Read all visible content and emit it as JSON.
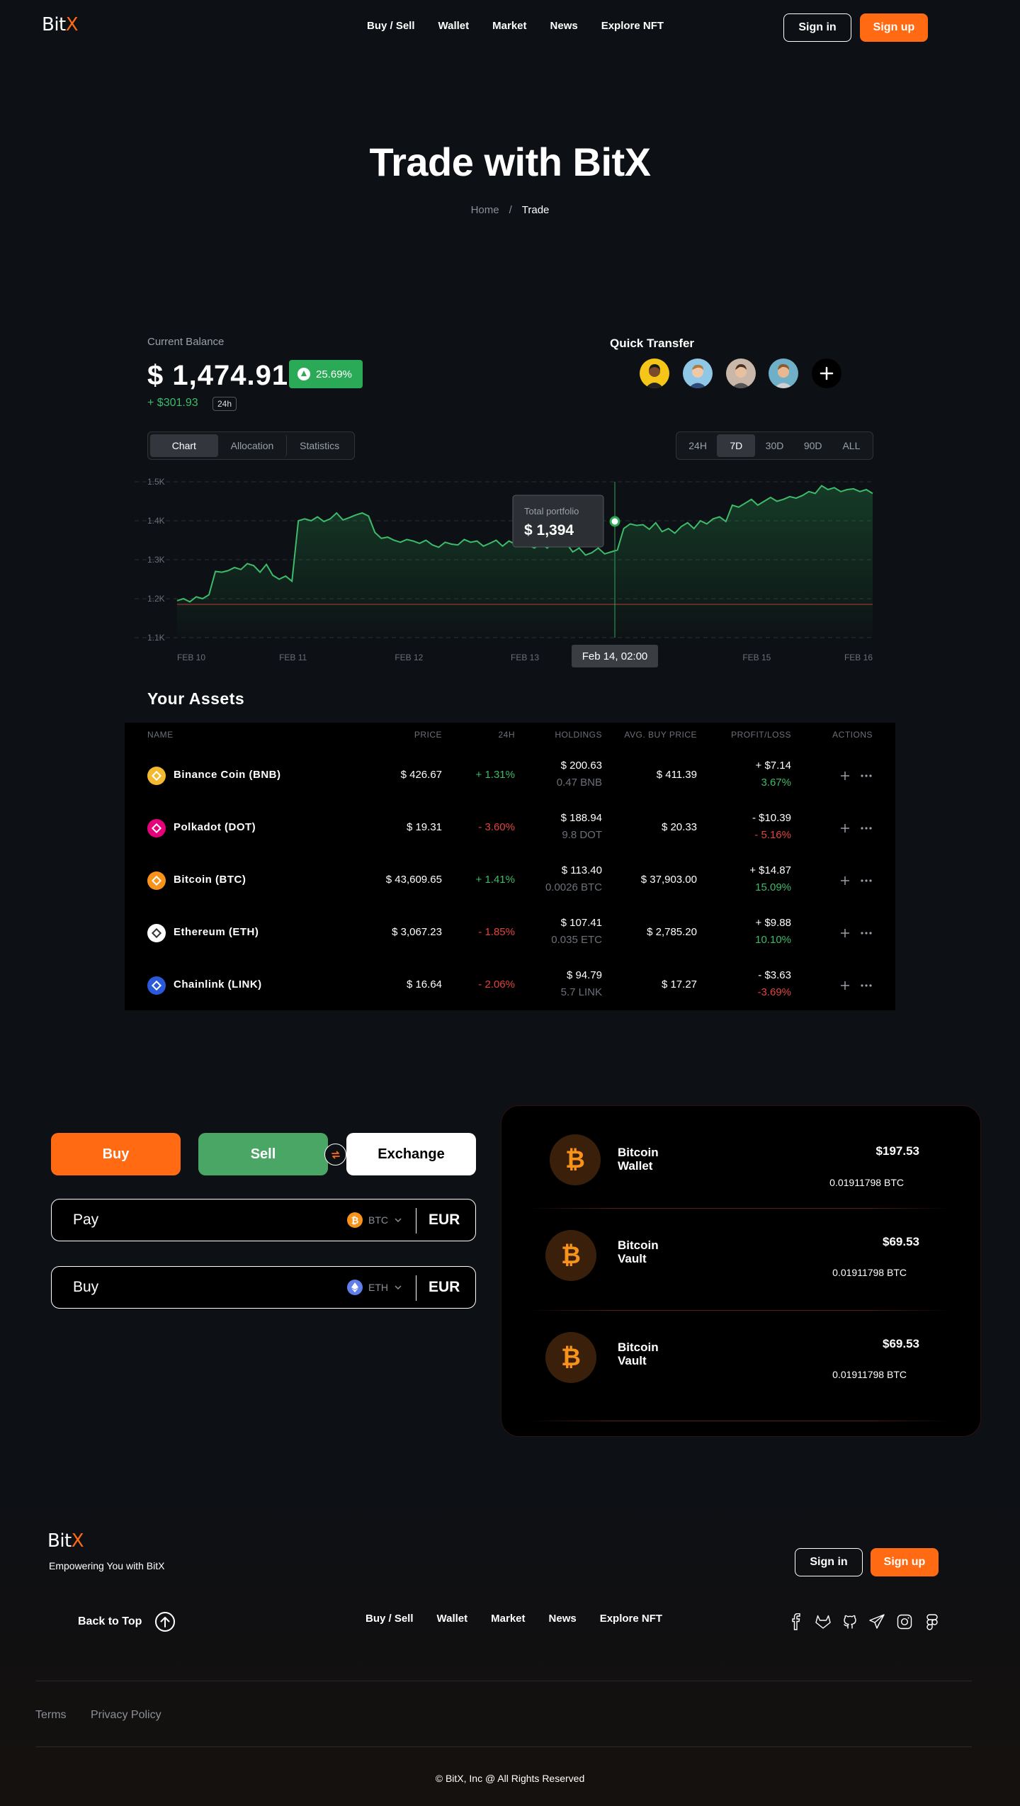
{
  "header": {
    "logo_main": "Bit",
    "logo_accent": "X",
    "nav": [
      "Buy / Sell",
      "Wallet",
      "Market",
      "News",
      "Explore NFT"
    ],
    "sign_in": "Sign in",
    "sign_up": "Sign up"
  },
  "hero": {
    "title": "Trade with BitX",
    "breadcrumb_home": "Home",
    "breadcrumb_sep": "/",
    "breadcrumb_current": "Trade"
  },
  "balance": {
    "label": "Current Balance",
    "value": "$ 1,474.91",
    "change_pct": "25.69%",
    "gain": "+ $301.93",
    "period": "24h"
  },
  "quick_transfer": {
    "label": "Quick Transfer"
  },
  "chart_tabs": [
    "Chart",
    "Allocation",
    "Statistics"
  ],
  "active_chart_tab": "Chart",
  "ranges": [
    "24H",
    "7D",
    "30D",
    "90D",
    "ALL"
  ],
  "active_range": "7D",
  "chart_data": {
    "type": "area",
    "y_ticks": [
      "1.5K",
      "1.4K",
      "1.3K",
      "1.2K",
      "1.1K"
    ],
    "x_ticks": [
      "FEB 10",
      "FEB 11",
      "FEB 12",
      "FEB 13",
      "FEB 14",
      "FEB 15",
      "FEB 16"
    ],
    "ylim": [
      1100,
      1500
    ],
    "grid": true,
    "values": [
      1195,
      1200,
      1192,
      1205,
      1200,
      1210,
      1270,
      1268,
      1272,
      1280,
      1275,
      1290,
      1285,
      1268,
      1288,
      1260,
      1250,
      1258,
      1245,
      1400,
      1405,
      1400,
      1410,
      1398,
      1405,
      1420,
      1402,
      1408,
      1415,
      1420,
      1412,
      1370,
      1355,
      1358,
      1350,
      1345,
      1352,
      1348,
      1342,
      1350,
      1338,
      1332,
      1345,
      1340,
      1338,
      1352,
      1345,
      1348,
      1335,
      1342,
      1350,
      1335,
      1348,
      1340,
      1345,
      1338,
      1330,
      1342,
      1330,
      1345,
      1335,
      1342,
      1320,
      1330,
      1312,
      1318,
      1330,
      1315,
      1320,
      1325,
      1380,
      1392,
      1388,
      1390,
      1378,
      1395,
      1372,
      1380,
      1368,
      1385,
      1395,
      1380,
      1400,
      1392,
      1405,
      1410,
      1398,
      1440,
      1435,
      1445,
      1455,
      1440,
      1450,
      1460,
      1450,
      1455,
      1462,
      1458,
      1465,
      1475,
      1470,
      1490,
      1480,
      1485,
      1475,
      1480,
      1482,
      1475,
      1480,
      1470
    ],
    "tooltip_label": "Total portfolio",
    "tooltip_value": "$ 1,394",
    "crosshair_label": "Feb 14, 02:00"
  },
  "assets": {
    "title": "Your Assets",
    "columns": [
      "NAME",
      "PRICE",
      "24H",
      "HOLDINGS",
      "AVG. BUY PRICE",
      "PROFIT/LOSS",
      "ACTIONS"
    ],
    "rows": [
      {
        "name": "Binance Coin (BNB)",
        "price": "$ 426.67",
        "change": "+ 1.31%",
        "holding_usd": "$ 200.63",
        "holding_amt": "0.47 BNB",
        "avg": "$ 411.39",
        "pl_usd": "+ $7.14",
        "pl_pct": "3.67%",
        "color": "#f3ba2f",
        "up": true
      },
      {
        "name": "Polkadot (DOT)",
        "price": "$ 19.31",
        "change": "- 3.60%",
        "holding_usd": "$ 188.94",
        "holding_amt": "9.8 DOT",
        "avg": "$ 20.33",
        "pl_usd": "- $10.39",
        "pl_pct": "- 5.16%",
        "color": "#e6007a",
        "up": false
      },
      {
        "name": "Bitcoin (BTC)",
        "price": "$ 43,609.65",
        "change": "+ 1.41%",
        "holding_usd": "$ 113.40",
        "holding_amt": "0.0026 BTC",
        "avg": "$ 37,903.00",
        "pl_usd": "+ $14.87",
        "pl_pct": "15.09%",
        "color": "#f7931a",
        "up": true
      },
      {
        "name": "Ethereum (ETH)",
        "price": "$ 3,067.23",
        "change": "- 1.85%",
        "holding_usd": "$ 107.41",
        "holding_amt": "0.035 ETC",
        "avg": "$ 2,785.20",
        "pl_usd": "+ $9.88",
        "pl_pct": "10.10%",
        "color": "#ffffff",
        "up": true
      },
      {
        "name": "Chainlink (LINK)",
        "price": "$ 16.64",
        "change": "- 2.06%",
        "holding_usd": "$ 94.79",
        "holding_amt": "5.7 LINK",
        "avg": "$ 17.27",
        "pl_usd": "- $3.63",
        "pl_pct": "-3.69%",
        "color": "#2a5ada",
        "up": true
      }
    ]
  },
  "trade": {
    "buy": "Buy",
    "sell": "Sell",
    "exchange": "Exchange",
    "pay_label": "Pay",
    "pay_coin": "BTC",
    "pay_currency": "EUR",
    "buy_label": "Buy",
    "buy_coin": "ETH",
    "buy_currency": "EUR"
  },
  "wallets": [
    {
      "name_1": "Bitcoin",
      "name_2": "Wallet",
      "usd": "$197.53",
      "btc": "0.01911798 BTC"
    },
    {
      "name_1": "Bitcoin",
      "name_2": "Vault",
      "usd": "$69.53",
      "btc": "0.01911798 BTC"
    },
    {
      "name_1": "Bitcoin",
      "name_2": "Vault",
      "usd": "$69.53",
      "btc": "0.01911798 BTC"
    }
  ],
  "footer": {
    "logo_main": "Bit",
    "logo_accent": "X",
    "tagline": "Empowering You with BitX",
    "sign_in": "Sign in",
    "sign_up": "Sign up",
    "back_to_top": "Back to Top",
    "nav": [
      "Buy / Sell",
      "Wallet",
      "Market",
      "News",
      "Explore NFT"
    ],
    "terms": "Terms",
    "privacy": "Privacy Policy",
    "copyright": "© BitX, Inc @ All Rights Reserved"
  },
  "colors": {
    "accent": "#ff6a13",
    "green": "#3dbb6a",
    "red": "#e0443d",
    "bg": "#0d1014"
  }
}
